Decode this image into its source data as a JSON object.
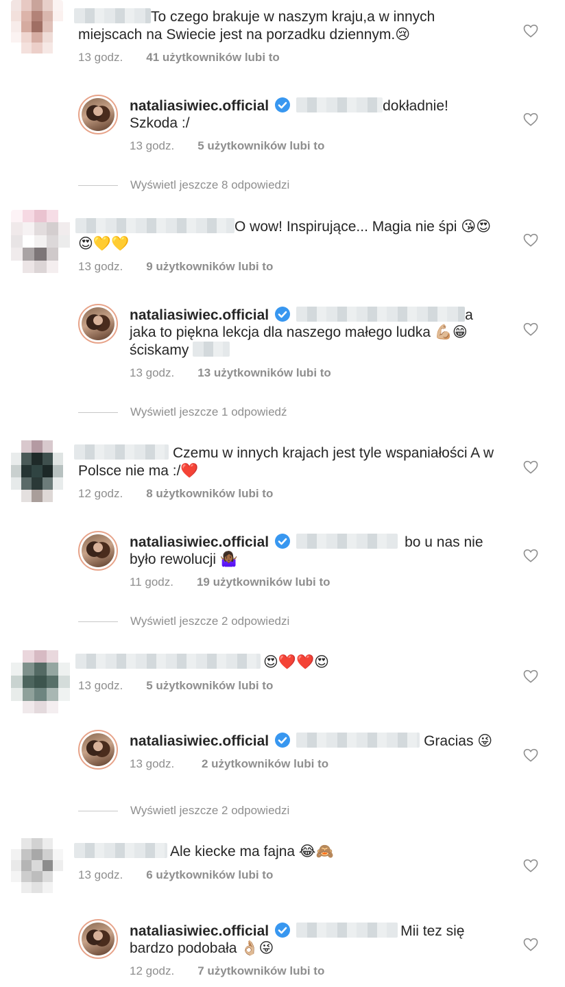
{
  "threads": [
    {
      "comment": {
        "line1": "To czego brakuje w naszym kraju,a w innych",
        "line2": "miejscach na Swiecie jest na porzadku dziennym.😢",
        "time": "13 godz.",
        "likes": "41 użytkowników lubi to"
      },
      "reply": {
        "username": "nataliasiwiec.official",
        "line1": "dokładnie!",
        "line2": "Szkoda :/",
        "time": "13 godz.",
        "likes": "5 użytkowników lubi to"
      },
      "view_more": "Wyświetl jeszcze 8 odpowiedzi"
    },
    {
      "comment": {
        "line1": "O wow! Inspirujące... Magia nie śpi 😘😍",
        "line2": "😍💛💛",
        "time": "13 godz.",
        "likes": "9 użytkowników lubi to"
      },
      "reply": {
        "username": "nataliasiwiec.official",
        "line1": "a",
        "line2": "jaka to piękna lekcja dla naszego małego ludka 💪🏼😁",
        "line3": "ściskamy",
        "time": "13 godz.",
        "likes": "13 użytkowników lubi to"
      },
      "view_more": "Wyświetl jeszcze 1 odpowiedź"
    },
    {
      "comment": {
        "line1": "Czemu w innych krajach jest tyle wspaniałości A w",
        "line2": "Polsce nie ma :/❤️",
        "time": "12 godz.",
        "likes": "8 użytkowników lubi to"
      },
      "reply": {
        "username": "nataliasiwiec.official",
        "line1": "bo u nas nie",
        "line2": "było rewolucji 🤷🏾‍♀️",
        "time": "11 godz.",
        "likes": "19 użytkowników lubi to"
      },
      "view_more": "Wyświetl jeszcze 2 odpowiedzi"
    },
    {
      "comment": {
        "line1": "😍❤️❤️😍",
        "time": "13 godz.",
        "likes": "5 użytkowników lubi to"
      },
      "reply": {
        "username": "nataliasiwiec.official",
        "line1": "Gracias 😜",
        "time": "13 godz.",
        "likes": "2 użytkowników lubi to"
      },
      "view_more": "Wyświetl jeszcze 2 odpowiedzi"
    },
    {
      "comment": {
        "line1": "Ale kiecke ma fajna 😂🙈",
        "time": "13 godz.",
        "likes": "6 użytkowników lubi to"
      },
      "reply": {
        "username": "nataliasiwiec.official",
        "line1": "Mii tez się",
        "line2": "bardzo podobała 👌🏼😜",
        "time": "12 godz.",
        "likes": "7 użytkowników lubi to"
      }
    }
  ],
  "icons": {
    "like": "heart-outline-icon",
    "verified": "verified-badge-icon"
  },
  "colors": {
    "verified": "#3897f0",
    "meta_text": "#8e8e8e",
    "text": "#262626"
  }
}
